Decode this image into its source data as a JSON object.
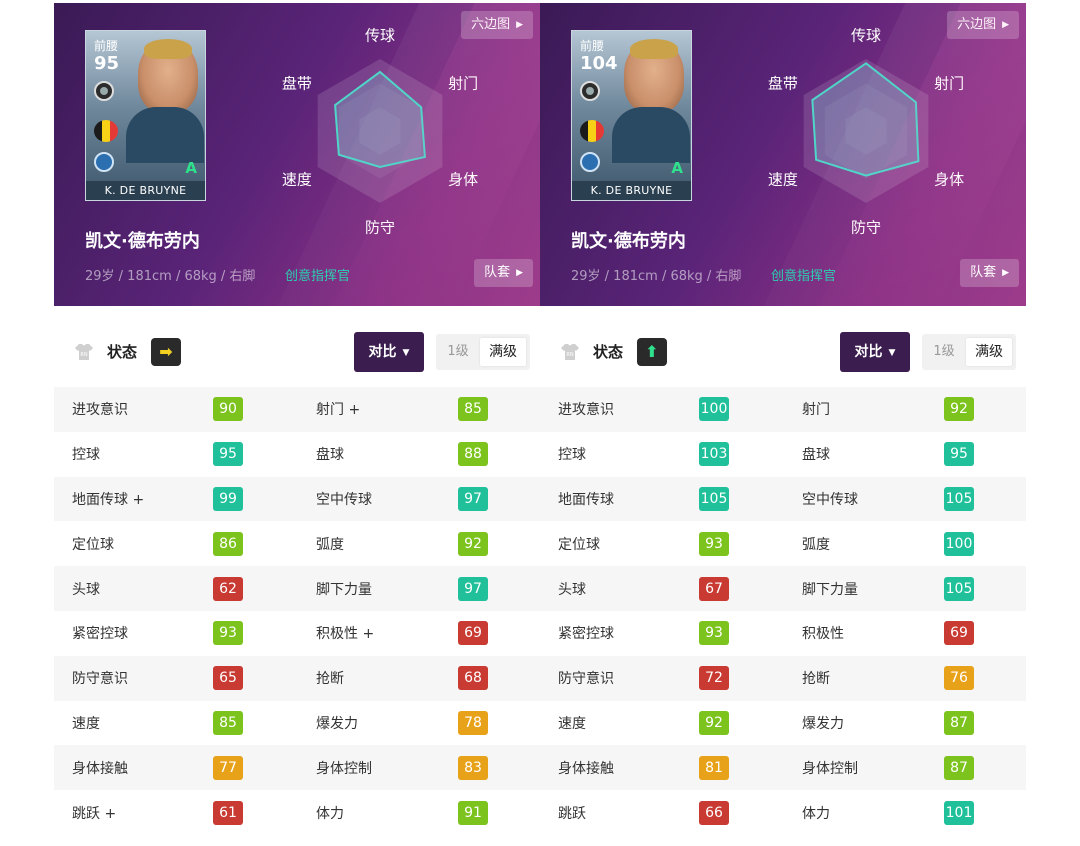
{
  "panels": [
    {
      "card": {
        "position": "前腰",
        "rating": "95",
        "name": "K. DE BRUYNE",
        "grade": "A",
        "flag_colors": [
          "#1b1b1b",
          "#f7d116",
          "#e53935"
        ]
      },
      "hex_button": "六边图",
      "team_button": "队套",
      "radar": {
        "labels": [
          "传球",
          "射门",
          "身体",
          "防守",
          "速度",
          "盘带"
        ],
        "values": [
          0.82,
          0.66,
          0.72,
          0.5,
          0.66,
          0.72
        ]
      },
      "player_name": "凯文·德布劳内",
      "player_info": "29岁 / 181cm / 68kg / 右脚",
      "play_style": "创意指挥官",
      "status_label": "状态",
      "condition_arrow": "➡",
      "condition_color": "#f4d020",
      "compare_button": "对比",
      "level_1": "1级",
      "level_max": "满级",
      "stats": [
        {
          "l": "进攻意识",
          "lv": "90",
          "lc": "#7cc31d",
          "r": "射门 +",
          "rv": "85",
          "rc": "#7cc31d"
        },
        {
          "l": "控球",
          "lv": "95",
          "lc": "#1fc09a",
          "r": "盘球",
          "rv": "88",
          "rc": "#7cc31d"
        },
        {
          "l": "地面传球 +",
          "lv": "99",
          "lc": "#1fc09a",
          "r": "空中传球",
          "rv": "97",
          "rc": "#1fc09a"
        },
        {
          "l": "定位球",
          "lv": "86",
          "lc": "#7cc31d",
          "r": "弧度",
          "rv": "92",
          "rc": "#7cc31d"
        },
        {
          "l": "头球",
          "lv": "62",
          "lc": "#c83a32",
          "r": "脚下力量",
          "rv": "97",
          "rc": "#1fc09a"
        },
        {
          "l": "紧密控球",
          "lv": "93",
          "lc": "#7cc31d",
          "r": "积极性 +",
          "rv": "69",
          "rc": "#c83a32"
        },
        {
          "l": "防守意识",
          "lv": "65",
          "lc": "#c83a32",
          "r": "抢断",
          "rv": "68",
          "rc": "#c83a32"
        },
        {
          "l": "速度",
          "lv": "85",
          "lc": "#7cc31d",
          "r": "爆发力",
          "rv": "78",
          "rc": "#e8a21a"
        },
        {
          "l": "身体接触",
          "lv": "77",
          "lc": "#e8a21a",
          "r": "身体控制",
          "rv": "83",
          "rc": "#e8a21a"
        },
        {
          "l": "跳跃 +",
          "lv": "61",
          "lc": "#c83a32",
          "r": "体力",
          "rv": "91",
          "rc": "#7cc31d"
        }
      ]
    },
    {
      "card": {
        "position": "前腰",
        "rating": "104",
        "name": "K. DE BRUYNE",
        "grade": "A",
        "flag_colors": [
          "#1b1b1b",
          "#f7d116",
          "#e53935"
        ]
      },
      "hex_button": "六边图",
      "team_button": "队套",
      "radar": {
        "labels": [
          "传球",
          "射门",
          "身体",
          "防守",
          "速度",
          "盘带"
        ],
        "values": [
          0.94,
          0.8,
          0.84,
          0.62,
          0.8,
          0.86
        ]
      },
      "player_name": "凯文·德布劳内",
      "player_info": "29岁 / 181cm / 68kg / 右脚",
      "play_style": "创意指挥官",
      "status_label": "状态",
      "condition_arrow": "⬆",
      "condition_color": "#2fe08c",
      "compare_button": "对比",
      "level_1": "1级",
      "level_max": "满级",
      "stats": [
        {
          "l": "进攻意识",
          "lv": "100",
          "lc": "#1fc09a",
          "r": "射门",
          "rv": "92",
          "rc": "#7cc31d"
        },
        {
          "l": "控球",
          "lv": "103",
          "lc": "#1fc09a",
          "r": "盘球",
          "rv": "95",
          "rc": "#1fc09a"
        },
        {
          "l": "地面传球",
          "lv": "105",
          "lc": "#1fc09a",
          "r": "空中传球",
          "rv": "105",
          "rc": "#1fc09a"
        },
        {
          "l": "定位球",
          "lv": "93",
          "lc": "#7cc31d",
          "r": "弧度",
          "rv": "100",
          "rc": "#1fc09a"
        },
        {
          "l": "头球",
          "lv": "67",
          "lc": "#c83a32",
          "r": "脚下力量",
          "rv": "105",
          "rc": "#1fc09a"
        },
        {
          "l": "紧密控球",
          "lv": "93",
          "lc": "#7cc31d",
          "r": "积极性",
          "rv": "69",
          "rc": "#c83a32"
        },
        {
          "l": "防守意识",
          "lv": "72",
          "lc": "#c83a32",
          "r": "抢断",
          "rv": "76",
          "rc": "#e8a21a"
        },
        {
          "l": "速度",
          "lv": "92",
          "lc": "#7cc31d",
          "r": "爆发力",
          "rv": "87",
          "rc": "#7cc31d"
        },
        {
          "l": "身体接触",
          "lv": "81",
          "lc": "#e8a21a",
          "r": "身体控制",
          "rv": "87",
          "rc": "#7cc31d"
        },
        {
          "l": "跳跃",
          "lv": "66",
          "lc": "#c83a32",
          "r": "体力",
          "rv": "101",
          "rc": "#1fc09a"
        }
      ]
    }
  ]
}
